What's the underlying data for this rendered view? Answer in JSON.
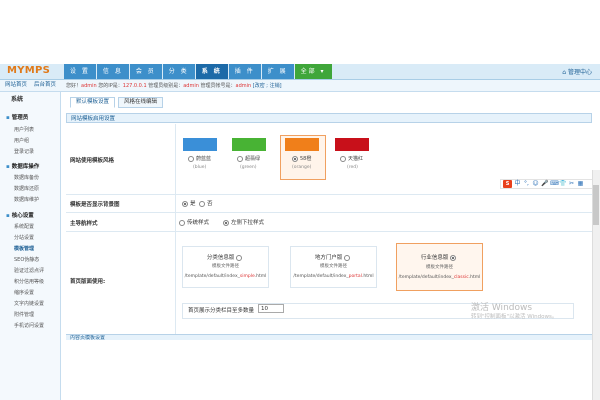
{
  "logo": "MYMPS",
  "nav": [
    "设 置",
    "信 息",
    "会 员",
    "分 类",
    "系 统",
    "插 件",
    "扩 展",
    "全部 ▾"
  ],
  "nav_active": 4,
  "admin_center": "管理中心",
  "subbar": {
    "home": "网站首页",
    "backend": "后台首页"
  },
  "greeting": {
    "pre": "您好！",
    "user": "admin",
    "ip_pre": " 您的IP是：",
    "ip": "127.0.0.1",
    "mid": "  管理员级别是：",
    "level": "admin",
    "acct": "  管理员帐号是：",
    "acct_val": "admin",
    "links": " [改密 ; 注销]"
  },
  "sidebar": {
    "title": "系统",
    "groups": [
      {
        "label": "管理员",
        "items": [
          "用户列表",
          "用户组",
          "登录记录"
        ]
      },
      {
        "label": "数据库操作",
        "items": [
          "数据库备份",
          "数据库还原",
          "数据库维护"
        ]
      },
      {
        "label": "核心设置",
        "items": [
          "系统配置",
          "分站设置",
          "模板管理",
          "SEO伪静态",
          "验证过滤点评",
          "积分信用等级",
          "缩序设置",
          "文字内链设置",
          "附件管理",
          "手机访问设置"
        ]
      }
    ],
    "active_item": "模板管理"
  },
  "tabs": [
    "默认模板设置",
    "风格在线编辑"
  ],
  "section_title": "网站模板启用设置",
  "rows": {
    "style_label": "网站使用模板风格",
    "bg_label": "模板是否显示背景图",
    "nav_label": "主导航样式",
    "home_label": "首页版面使用:"
  },
  "styles": [
    {
      "name": "蔚蓝蓝",
      "code": "(blue)",
      "color": "#3a8fd8",
      "selected": false
    },
    {
      "name": "超翡绿",
      "code": "(green)",
      "color": "#48b334",
      "selected": false
    },
    {
      "name": "58橙",
      "code": "(orange)",
      "color": "#f07f1a",
      "selected": true
    },
    {
      "name": "天猫红",
      "code": "(red)",
      "color": "#c8101a",
      "selected": false
    }
  ],
  "bg_options": [
    {
      "label": "是",
      "on": true
    },
    {
      "label": "否",
      "on": false
    }
  ],
  "nav_options": [
    {
      "label": "传统样式",
      "on": false
    },
    {
      "label": "左侧下拉样式",
      "on": true
    }
  ],
  "home_cards": [
    {
      "title": "分类信息版",
      "sub": "模板文件路径",
      "path_pre": "/template/default/index_",
      "path_hl": "simple",
      "path_post": ".html",
      "selected": false
    },
    {
      "title": "地方门户版",
      "sub": "模板文件路径",
      "path_pre": "/template/default/index_",
      "path_hl": "portal",
      "path_post": ".html",
      "selected": false
    },
    {
      "title": "行业信息版",
      "sub": "模板文件路径",
      "path_pre": "/template/default/index_",
      "path_hl": "classic",
      "path_post": ".html",
      "selected": true
    }
  ],
  "count_label": "首页展示分类栏目至多数量",
  "count_value": "10",
  "watermark": {
    "line1": "激活 Windows",
    "line2": "转到\"控制面板\"以激活 Windows。"
  },
  "toolbar": {
    "logo": "S",
    "icons": [
      "中",
      "°,",
      "☺",
      "🎤",
      "⌨",
      "👕",
      "✂",
      "▦"
    ]
  },
  "bottom_text": "内容页模板设置"
}
